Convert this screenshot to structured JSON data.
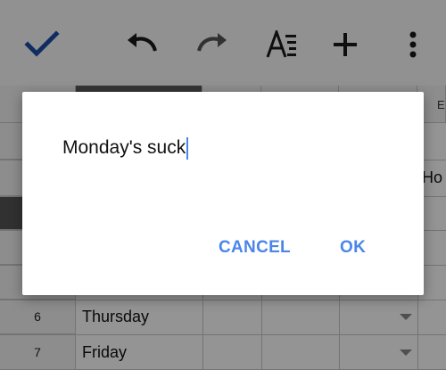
{
  "toolbar": {
    "icons": [
      "check-icon",
      "undo-icon",
      "redo-icon",
      "text-format-icon",
      "add-icon",
      "more-vert-icon"
    ],
    "accent": "#4a86e8"
  },
  "sheet": {
    "partial_column_letter": "E",
    "partial_header_cell": "Ho",
    "rows": [
      {
        "number": "6",
        "cell": "Thursday"
      },
      {
        "number": "7",
        "cell": "Friday"
      }
    ]
  },
  "dialog": {
    "input_value": "Monday's suck",
    "cancel_label": "CANCEL",
    "ok_label": "OK"
  }
}
